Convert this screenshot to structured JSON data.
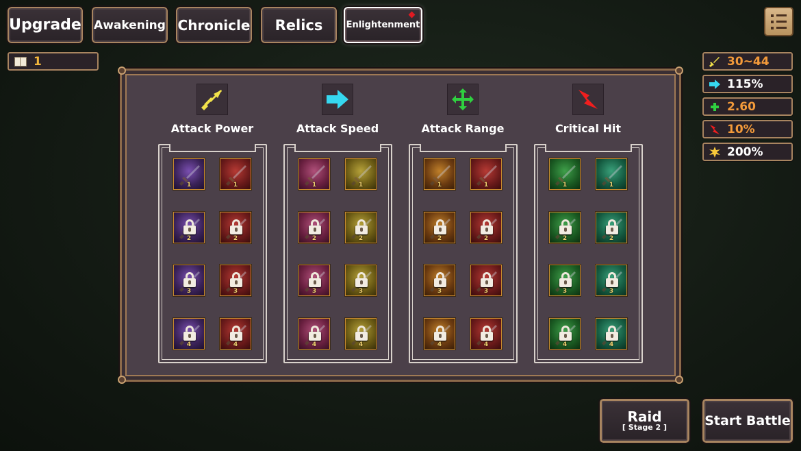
{
  "tabs": [
    {
      "label": "Upgrade",
      "active": false
    },
    {
      "label": "Awakening",
      "active": false
    },
    {
      "label": "Chronicle",
      "active": false
    },
    {
      "label": "Relics",
      "active": false
    },
    {
      "label": "Enlightenment",
      "active": true,
      "notification": true
    }
  ],
  "book": {
    "icon": "book-icon",
    "count": "1"
  },
  "stats": [
    {
      "icon": "sword-icon",
      "value": "30~44",
      "color": "#f39a3a"
    },
    {
      "icon": "speed-arrow-icon",
      "value": "115%",
      "color": "#ffffff"
    },
    {
      "icon": "range-cross-icon",
      "value": "2.60",
      "color": "#f39a3a"
    },
    {
      "icon": "critical-arrow-icon",
      "value": "10%",
      "color": "#f39a3a"
    },
    {
      "icon": "burst-star-icon",
      "value": "200%",
      "color": "#ffffff"
    }
  ],
  "categories": [
    {
      "label": "Attack Power",
      "icon": "sword-icon",
      "color": "#f2e24a"
    },
    {
      "label": "Attack Speed",
      "icon": "speed-arrow-icon",
      "color": "#36d8f0"
    },
    {
      "label": "Attack Range",
      "icon": "range-cross-icon",
      "color": "#2fd040"
    },
    {
      "label": "Critical Hit",
      "icon": "critical-arrow-icon",
      "color": "#f01e1e"
    }
  ],
  "skill_columns": [
    {
      "category": "Attack Power",
      "slots": [
        {
          "tier": "1",
          "locked": false
        },
        {
          "tier": "1",
          "locked": false
        },
        {
          "tier": "2",
          "locked": true
        },
        {
          "tier": "2",
          "locked": true
        },
        {
          "tier": "3",
          "locked": true
        },
        {
          "tier": "3",
          "locked": true
        },
        {
          "tier": "4",
          "locked": true
        },
        {
          "tier": "4",
          "locked": true
        }
      ]
    },
    {
      "category": "Attack Speed",
      "slots": [
        {
          "tier": "1",
          "locked": false
        },
        {
          "tier": "1",
          "locked": false
        },
        {
          "tier": "2",
          "locked": true
        },
        {
          "tier": "2",
          "locked": true
        },
        {
          "tier": "3",
          "locked": true
        },
        {
          "tier": "3",
          "locked": true
        },
        {
          "tier": "4",
          "locked": true
        },
        {
          "tier": "4",
          "locked": true
        }
      ]
    },
    {
      "category": "Attack Range",
      "slots": [
        {
          "tier": "1",
          "locked": false
        },
        {
          "tier": "1",
          "locked": false
        },
        {
          "tier": "2",
          "locked": true
        },
        {
          "tier": "2",
          "locked": true
        },
        {
          "tier": "3",
          "locked": true
        },
        {
          "tier": "3",
          "locked": true
        },
        {
          "tier": "4",
          "locked": true
        },
        {
          "tier": "4",
          "locked": true
        }
      ]
    },
    {
      "category": "Critical Hit",
      "slots": [
        {
          "tier": "1",
          "locked": false
        },
        {
          "tier": "1",
          "locked": false
        },
        {
          "tier": "2",
          "locked": true
        },
        {
          "tier": "2",
          "locked": true
        },
        {
          "tier": "3",
          "locked": true
        },
        {
          "tier": "3",
          "locked": true
        },
        {
          "tier": "4",
          "locked": true
        },
        {
          "tier": "4",
          "locked": true
        }
      ]
    }
  ],
  "buttons": {
    "raid": {
      "label": "Raid",
      "sub": "[ Stage 2 ]"
    },
    "start": {
      "label": "Start Battle"
    }
  },
  "colors": {
    "gold_text": "#f3b63c",
    "panel": "#4b4049",
    "frame": "#a88560"
  }
}
